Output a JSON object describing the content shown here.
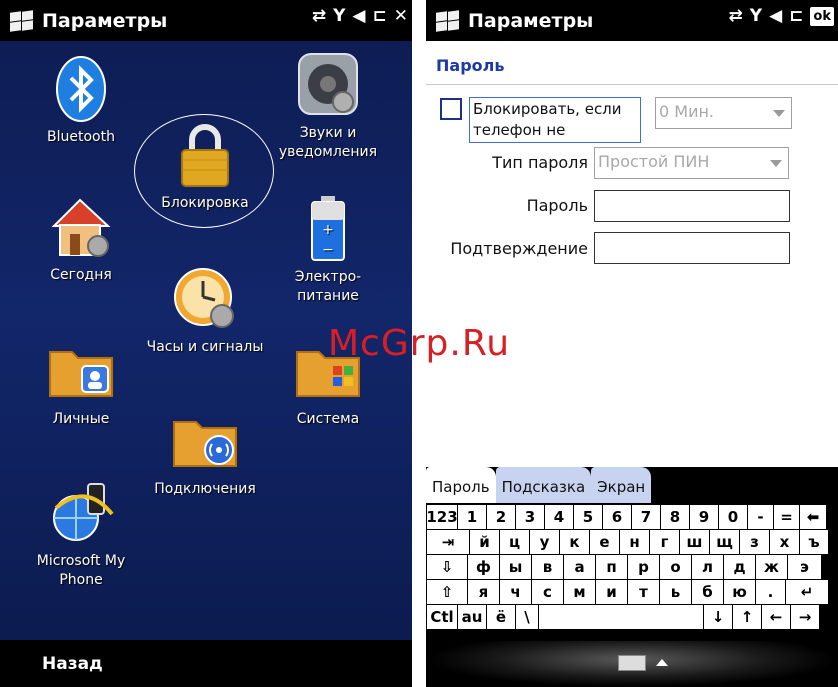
{
  "left": {
    "title": "Параметры",
    "status": {
      "data": "⇄",
      "signal": "Y",
      "sound": "◀",
      "battery": "⊏",
      "close": "✕"
    },
    "apps": [
      {
        "name": "app-bluetooth",
        "label": "Bluetooth",
        "icon": "bluetooth-icon"
      },
      {
        "name": "app-sounds",
        "label": "Звуки и\nуведомления",
        "icon": "speaker-icon"
      },
      {
        "name": "app-lock",
        "label": "Блокировка",
        "icon": "padlock-icon"
      },
      {
        "name": "app-today",
        "label": "Сегодня",
        "icon": "house-icon"
      },
      {
        "name": "app-power",
        "label": "Электро-\nпитание",
        "icon": "battery-icon"
      },
      {
        "name": "app-clock",
        "label": "Часы и сигналы",
        "icon": "clock-icon"
      },
      {
        "name": "app-personal",
        "label": "Личные",
        "icon": "personal-folder-icon"
      },
      {
        "name": "app-system",
        "label": "Система",
        "icon": "system-folder-icon"
      },
      {
        "name": "app-connections",
        "label": "Подключения",
        "icon": "connections-folder-icon"
      },
      {
        "name": "app-my-phone",
        "label": "Microsoft My\nPhone",
        "icon": "globe-phone-icon"
      }
    ],
    "softkey": "Назад"
  },
  "right": {
    "title": "Параметры",
    "status": {
      "data": "⇄",
      "signal": "Y",
      "sound": "◀",
      "battery": "⊏",
      "ok": "ok"
    },
    "section": "Пароль",
    "lock_label": "Блокировать, если\nтелефон не",
    "lock_minutes": "0 Мин.",
    "password_type_label": "Тип пароля",
    "password_type_value": "Простой ПИН",
    "password_label": "Пароль",
    "confirm_label": "Подтверждение",
    "tabs": [
      "Пароль",
      "Подсказка",
      "Экран"
    ],
    "keyboard": [
      [
        "123",
        "1",
        "2",
        "3",
        "4",
        "5",
        "6",
        "7",
        "8",
        "9",
        "0",
        "-",
        "=",
        "⬅"
      ],
      [
        "⇥",
        "й",
        "ц",
        "у",
        "к",
        "е",
        "н",
        "г",
        "ш",
        "щ",
        "з",
        "х",
        "ъ"
      ],
      [
        "⇩",
        "ф",
        "ы",
        "в",
        "а",
        "п",
        "р",
        "о",
        "л",
        "д",
        "ж",
        "э"
      ],
      [
        "⇧",
        "я",
        "ч",
        "с",
        "м",
        "и",
        "т",
        "ь",
        "б",
        "ю",
        ".",
        "↵"
      ],
      [
        "Ctl",
        "au",
        "ё",
        "\\",
        " ",
        "↓",
        "↑",
        "←",
        "→"
      ]
    ]
  },
  "watermark": "McGrp.Ru",
  "colors": {
    "accent": "#1b3aa8",
    "background_left": "#12266a",
    "watermark": "#d81f26"
  }
}
